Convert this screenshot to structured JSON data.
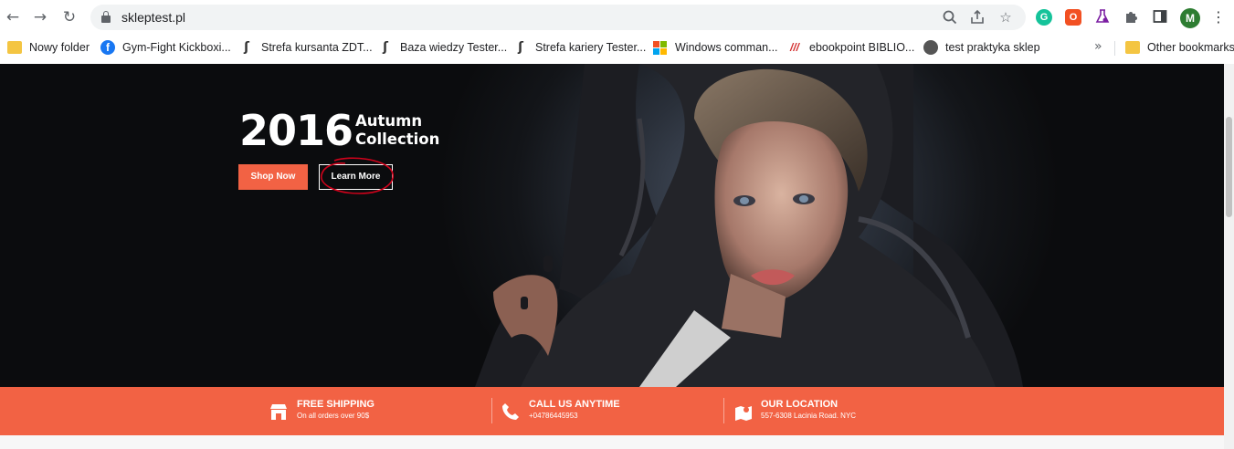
{
  "browser": {
    "url": "skleptest.pl",
    "profile_initial": "M",
    "extensions": [
      "G",
      "O"
    ]
  },
  "bookmarks": {
    "items": [
      {
        "label": "Nowy folder",
        "icon": "folder-icon"
      },
      {
        "label": "Gym-Fight Kickboxi...",
        "icon": "facebook-icon"
      },
      {
        "label": "Strefa kursanta ZDT...",
        "icon": "s-logo-icon"
      },
      {
        "label": "Baza wiedzy Tester...",
        "icon": "s-logo-icon"
      },
      {
        "label": "Strefa kariery Tester...",
        "icon": "s-logo-icon"
      },
      {
        "label": "Windows comman...",
        "icon": "microsoft-icon"
      },
      {
        "label": "ebookpoint BIBLIO...",
        "icon": "ebookpoint-icon"
      },
      {
        "label": "test praktyka sklep",
        "icon": "globe-icon"
      }
    ],
    "more": "»",
    "other": "Other bookmarks"
  },
  "hero": {
    "year": "2016",
    "line1": "Autumn",
    "line2": "Collection",
    "shop_label": "Shop Now",
    "learn_label": "Learn More"
  },
  "features": [
    {
      "title": "FREE SHIPPING",
      "subtitle": "On all orders over 90$",
      "icon": "shop-icon"
    },
    {
      "title": "CALL US ANYTIME",
      "subtitle": "+04786445953",
      "icon": "phone-icon"
    },
    {
      "title": "OUR LOCATION",
      "subtitle": "557-6308 Lacinia Road. NYC",
      "icon": "map-icon"
    }
  ],
  "colors": {
    "accent": "#f26244",
    "hero_bg": "#0b0c0e",
    "annotation": "#d0021b"
  }
}
